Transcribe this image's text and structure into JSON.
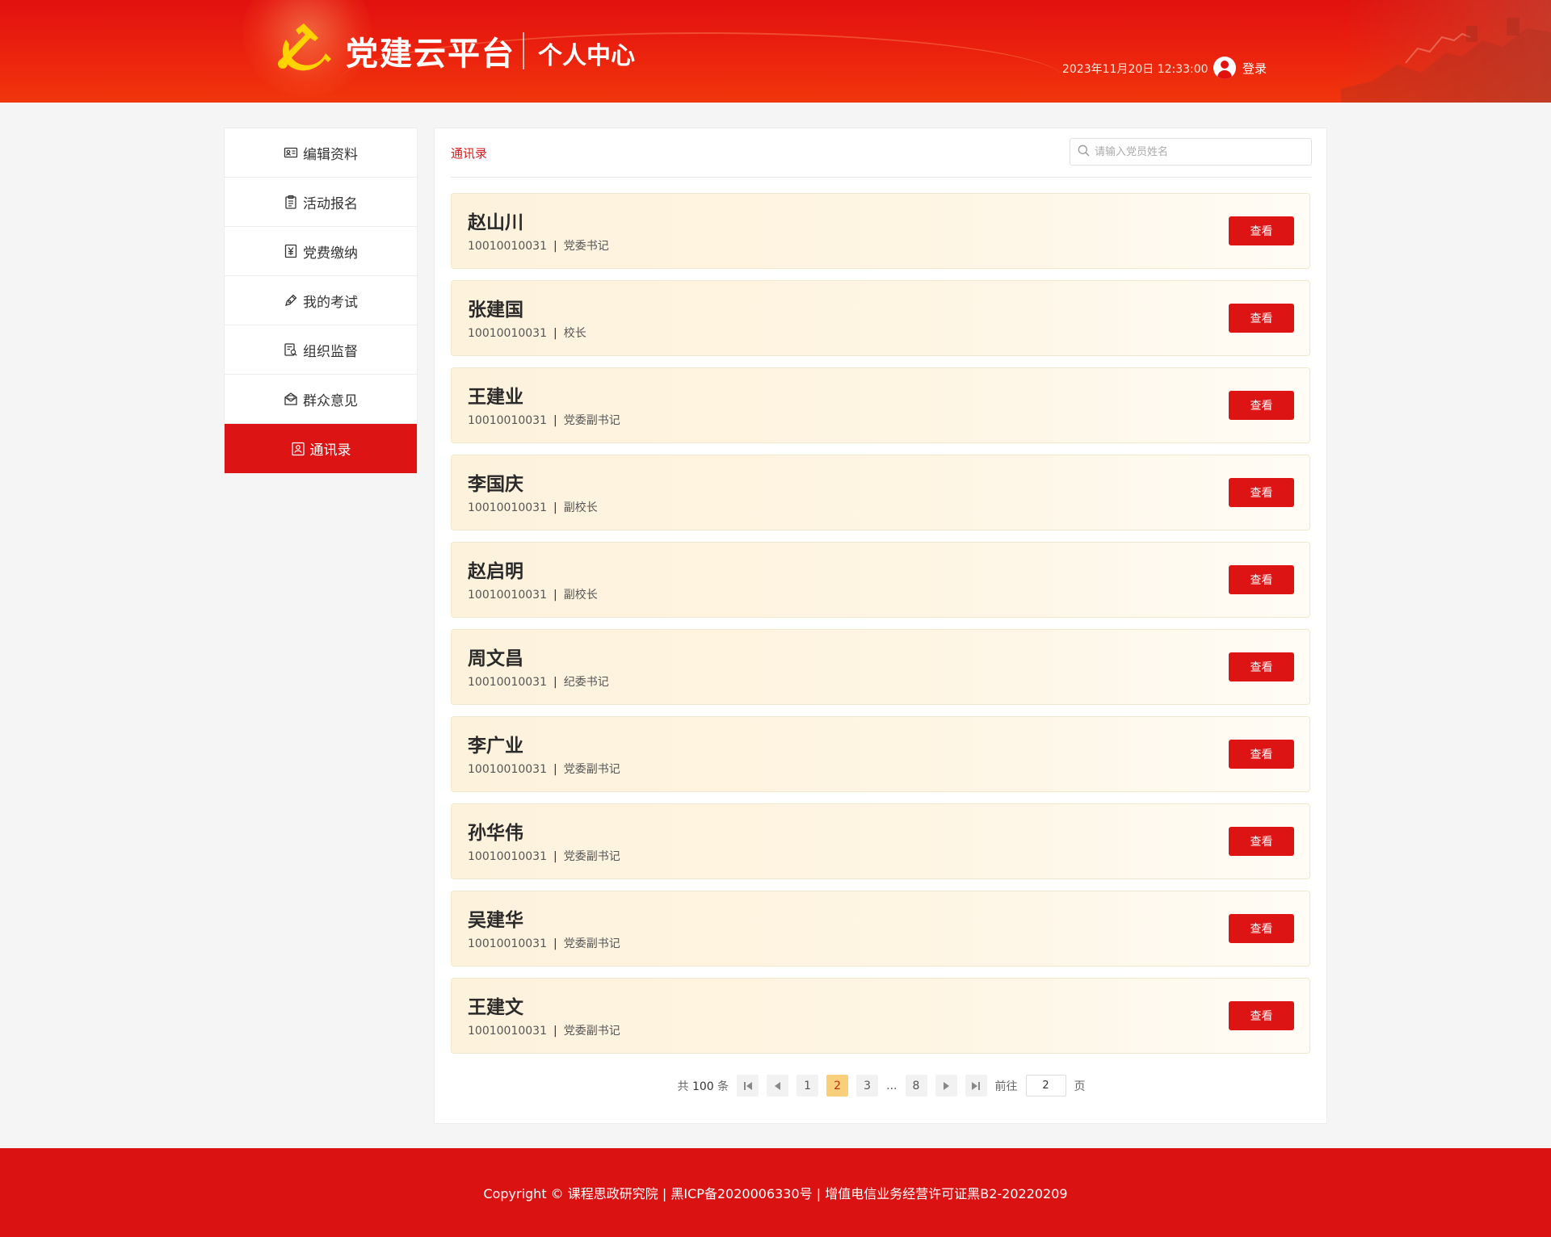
{
  "header": {
    "site_title": "党建云平台",
    "sub_title": "个人中心",
    "datetime": "2023年11月20日 12:33:00",
    "login_label": "登录"
  },
  "sidebar": {
    "items": [
      {
        "label": "编辑资料",
        "icon": "id-card-icon",
        "active": false
      },
      {
        "label": "活动报名",
        "icon": "clipboard-icon",
        "active": false
      },
      {
        "label": "党费缴纳",
        "icon": "yuan-icon",
        "active": false
      },
      {
        "label": "我的考试",
        "icon": "pen-icon",
        "active": false
      },
      {
        "label": "组织监督",
        "icon": "inspect-icon",
        "active": false
      },
      {
        "label": "群众意见",
        "icon": "mail-icon",
        "active": false
      },
      {
        "label": "通讯录",
        "icon": "contacts-icon",
        "active": true
      }
    ]
  },
  "main": {
    "tab_label": "通讯录",
    "search": {
      "placeholder": "请输入党员姓名",
      "value": ""
    },
    "view_label": "查看",
    "contacts": [
      {
        "name": "赵山川",
        "id": "10010010031",
        "position": "党委书记"
      },
      {
        "name": "张建国",
        "id": "10010010031",
        "position": "校长"
      },
      {
        "name": "王建业",
        "id": "10010010031",
        "position": "党委副书记"
      },
      {
        "name": "李国庆",
        "id": "10010010031",
        "position": "副校长"
      },
      {
        "name": "赵启明",
        "id": "10010010031",
        "position": "副校长"
      },
      {
        "name": "周文昌",
        "id": "10010010031",
        "position": "纪委书记"
      },
      {
        "name": "李广业",
        "id": "10010010031",
        "position": "党委副书记"
      },
      {
        "name": "孙华伟",
        "id": "10010010031",
        "position": "党委副书记"
      },
      {
        "name": "吴建华",
        "id": "10010010031",
        "position": "党委副书记"
      },
      {
        "name": "王建文",
        "id": "10010010031",
        "position": "党委副书记"
      }
    ]
  },
  "pagination": {
    "total_prefix": "共",
    "total": "100",
    "total_suffix": "条",
    "pages": [
      "1",
      "2",
      "3",
      "...",
      "8"
    ],
    "current": "2",
    "goto_prefix": "前往",
    "goto_value": "2",
    "goto_suffix": "页"
  },
  "footer": {
    "copyright": "Copyright © 课程思政研究院 | 黑ICP备2020006330号 | 增值电信业务经营许可证黑B2-20220209"
  },
  "colors": {
    "primary_red": "#dc1414",
    "card_bg": "#fdf2dc",
    "current_page": "#f9cf7c"
  }
}
